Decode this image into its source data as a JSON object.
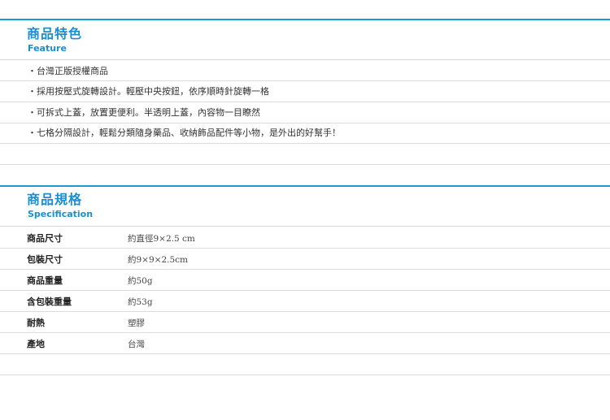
{
  "feature": {
    "title_zh": "商品特色",
    "title_en": "Feature",
    "items": [
      "・台灣正版授權商品",
      "・採用按壓式旋轉設計。輕壓中央按鈕，依序順時針旋轉一格",
      "・可拆式上蓋，放置更便利。半透明上蓋，內容物一目瞭然",
      "・七格分隔設計，輕鬆分類隨身藥品、收納飾品配件等小物，是外出的好幫手！"
    ]
  },
  "specification": {
    "title_zh": "商品規格",
    "title_en": "Specification",
    "rows": [
      {
        "key": "商品尺寸",
        "value": "約直徑9×2.5 cm"
      },
      {
        "key": "包裝尺寸",
        "value": "約9×9×2.5cm"
      },
      {
        "key": "商品重量",
        "value": "約50g"
      },
      {
        "key": "含包裝重量",
        "value": "約53g"
      },
      {
        "key": "耐熱",
        "value": "塑膠"
      },
      {
        "key": "產地",
        "value": "台灣"
      }
    ]
  },
  "colors": {
    "accent": "#1a9ad6",
    "rule": "#dcdcdc"
  }
}
